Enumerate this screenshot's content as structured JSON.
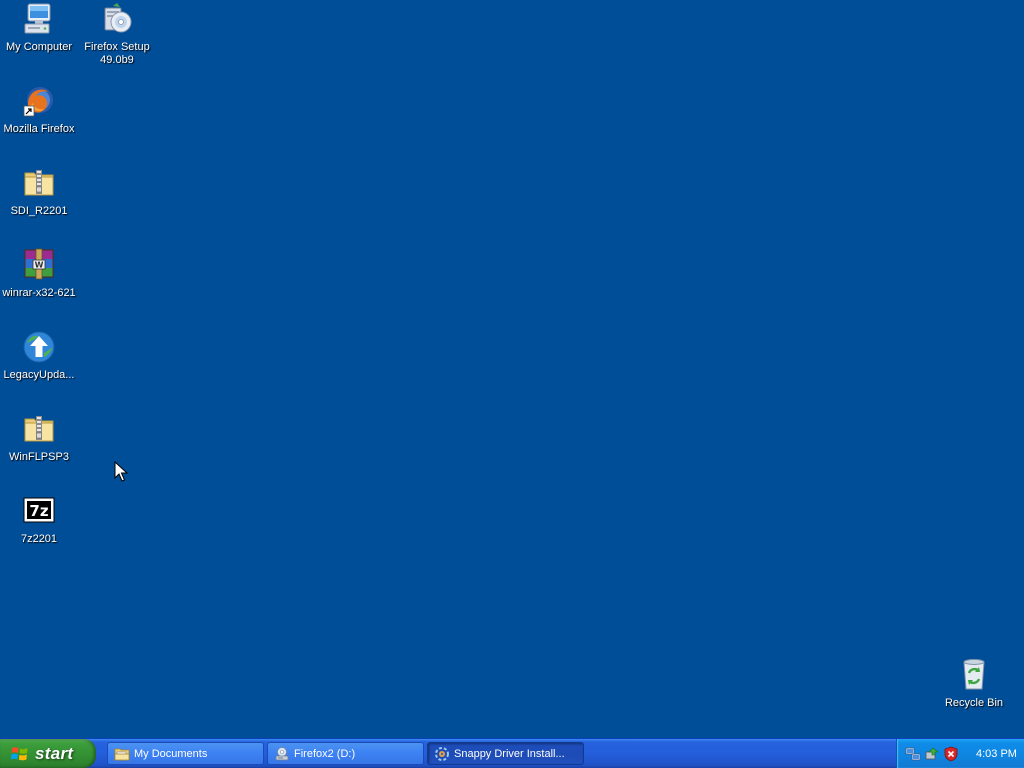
{
  "desktop": {
    "background_color": "#004E98",
    "icons": [
      {
        "name": "my-computer",
        "label": "My Computer"
      },
      {
        "name": "firefox-setup",
        "label": "Firefox Setup\n49.0b9"
      },
      {
        "name": "mozilla-firefox",
        "label": "Mozilla Firefox"
      },
      {
        "name": "sdi-r2201",
        "label": "SDI_R2201"
      },
      {
        "name": "winrar",
        "label": "winrar-x32-621"
      },
      {
        "name": "legacy-update",
        "label": "LegacyUpda..."
      },
      {
        "name": "winflpsp3",
        "label": "WinFLPSP3"
      },
      {
        "name": "7z2201",
        "label": "7z2201"
      },
      {
        "name": "recycle-bin",
        "label": "Recycle Bin"
      }
    ]
  },
  "taskbar": {
    "start_label": "start",
    "tasks": [
      {
        "label": "My Documents",
        "icon": "folder-icon",
        "active": false
      },
      {
        "label": "Firefox2 (D:)",
        "icon": "cd-drive-icon",
        "active": false
      },
      {
        "label": "Snappy Driver Install...",
        "icon": "snappy-driver-icon",
        "active": true
      }
    ],
    "tray": {
      "icons": [
        "network-icon",
        "safely-remove-icon",
        "security-shield-icon"
      ],
      "clock": "4:03 PM"
    }
  }
}
